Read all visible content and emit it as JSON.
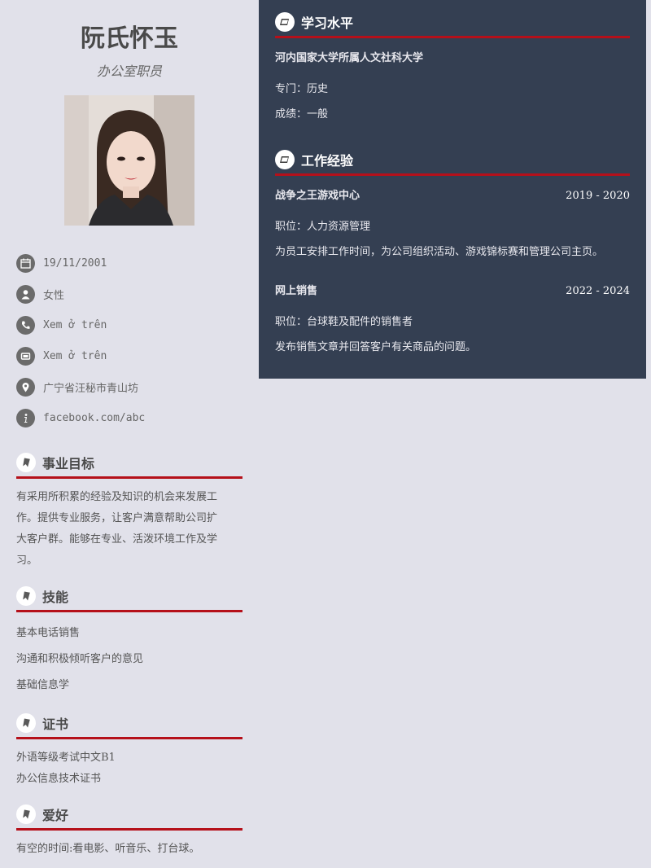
{
  "profile": {
    "name": "阮氏怀玉",
    "job_title": "办公室职员"
  },
  "contact": [
    {
      "icon": "calendar-icon",
      "text": "19/11/2001"
    },
    {
      "icon": "person-icon",
      "text": "女性"
    },
    {
      "icon": "phone-icon",
      "text": "Xem ở trên"
    },
    {
      "icon": "email-icon",
      "text": "Xem ở trên"
    },
    {
      "icon": "location-icon",
      "text": "广宁省汪秘市青山坊"
    },
    {
      "icon": "info-icon",
      "text": "facebook.com/abc"
    }
  ],
  "career_goal": {
    "heading": "事业目标",
    "lines": [
      "有采用所积累的经验及知识的机会来发展工",
      "作。提供专业服务，让客户满意帮助公司扩",
      "大客户群。能够在专业、活泼环境工作及学",
      "习。"
    ]
  },
  "skills": {
    "heading": "技能",
    "items": [
      "基本电话销售",
      "沟通和积极倾听客户的意见",
      "基础信息学"
    ]
  },
  "certificates": {
    "heading": "证书",
    "items": [
      "外语等级考试中文B1",
      "办公信息技术证书"
    ]
  },
  "hobbies": {
    "heading": "爱好",
    "text": "有空的时间:看电影、听音乐、打台球。"
  },
  "education": {
    "heading": "学习水平",
    "school": "河内国家大学所属人文社科大学",
    "major": "专门：历史",
    "grade": "成绩：一般"
  },
  "experience": {
    "heading": "工作经验",
    "jobs": [
      {
        "company": "战争之王游戏中心",
        "period": "2019 - 2020",
        "position": "职位：人力资源管理",
        "description": "为员工安排工作时间，为公司组织活动、游戏锦标赛和管理公司主页。"
      },
      {
        "company": "网上销售",
        "period": "2022 - 2024",
        "position": "职位：台球鞋及配件的销售者",
        "description": "发布销售文章并回答客户有关商品的问题。"
      }
    ]
  },
  "colors": {
    "sidebar_bg": "#e1e1ea",
    "main_bg": "#343f52",
    "accent_rule": "#b5101a"
  }
}
